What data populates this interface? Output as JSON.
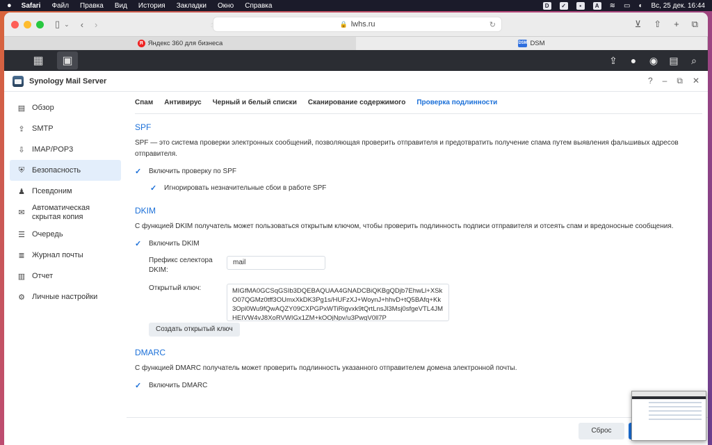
{
  "menubar": {
    "app": "Safari",
    "items": [
      "Файл",
      "Правка",
      "Вид",
      "История",
      "Закладки",
      "Окно",
      "Справка"
    ],
    "clock": "Вс, 25 дек.  16:44"
  },
  "browser": {
    "url": "lwhs.ru",
    "tabs": [
      {
        "label": "Яндекс 360 для бизнеса",
        "favicon": "Я"
      },
      {
        "label": "DSM",
        "favicon": "DSM"
      }
    ]
  },
  "app": {
    "title": "Synology Mail Server",
    "sidebar": [
      {
        "label": "Обзор",
        "icon": "overview-icon"
      },
      {
        "label": "SMTP",
        "icon": "smtp-icon"
      },
      {
        "label": "IMAP/POP3",
        "icon": "imap-icon"
      },
      {
        "label": "Безопасность",
        "icon": "shield-icon",
        "active": true
      },
      {
        "label": "Псевдоним",
        "icon": "alias-icon"
      },
      {
        "label": "Автоматическая скрытая копия",
        "icon": "auto-bcc-icon"
      },
      {
        "label": "Очередь",
        "icon": "queue-icon"
      },
      {
        "label": "Журнал почты",
        "icon": "mail-log-icon"
      },
      {
        "label": "Отчет",
        "icon": "report-icon"
      },
      {
        "label": "Личные настройки",
        "icon": "gear-icon"
      }
    ],
    "subtabs": [
      "Спам",
      "Антивирус",
      "Черный и белый списки",
      "Сканирование содержимого",
      "Проверка подлинности"
    ],
    "active_subtab": "Проверка подлинности",
    "spf": {
      "title": "SPF",
      "desc": "SPF — это система проверки электронных сообщений, позволяющая проверить отправителя и предотвратить получение спама путем выявления фальшивых адресов отправителя.",
      "enable_label": "Включить проверку по SPF",
      "ignore_label": "Игнорировать незначительные сбои в работе SPF"
    },
    "dkim": {
      "title": "DKIM",
      "desc": "С функцией DKIM получатель может пользоваться открытым ключом, чтобы проверить подлинность подписи отправителя и отсеять спам и вредоносные сообщения.",
      "enable_label": "Включить DKIM",
      "prefix_label": "Префикс селектора DKIM:",
      "prefix_value": "mail",
      "key_label": "Открытый ключ:",
      "key_value": "MIGfMA0GCSqGSIb3DQEBAQUAA4GNADCBiQKBgQDjb7EhwLl+XSkO07QGMz0tff3OUmxXkDK3Pg1s/HUFzXJ+WoynJ+hhvD+tQ5BAfq+Kk3Opl0Wu9fQwAQZY09CXPGPxWTiRigvxk9tQrtLnsJl3Msj0sfgeVTL4JMHEIVW4vJ8XoRVWIGx1ZM+kOOjNpv/u3PwgV0ll7P",
      "create_key_label": "Создать открытый ключ"
    },
    "dmarc": {
      "title": "DMARC",
      "desc": "С функцией DMARC получатель может проверить подлинность указанного отправителем домена электронной почты.",
      "enable_label": "Включить DMARC"
    },
    "footer": {
      "reset_label": "Сброс"
    }
  }
}
